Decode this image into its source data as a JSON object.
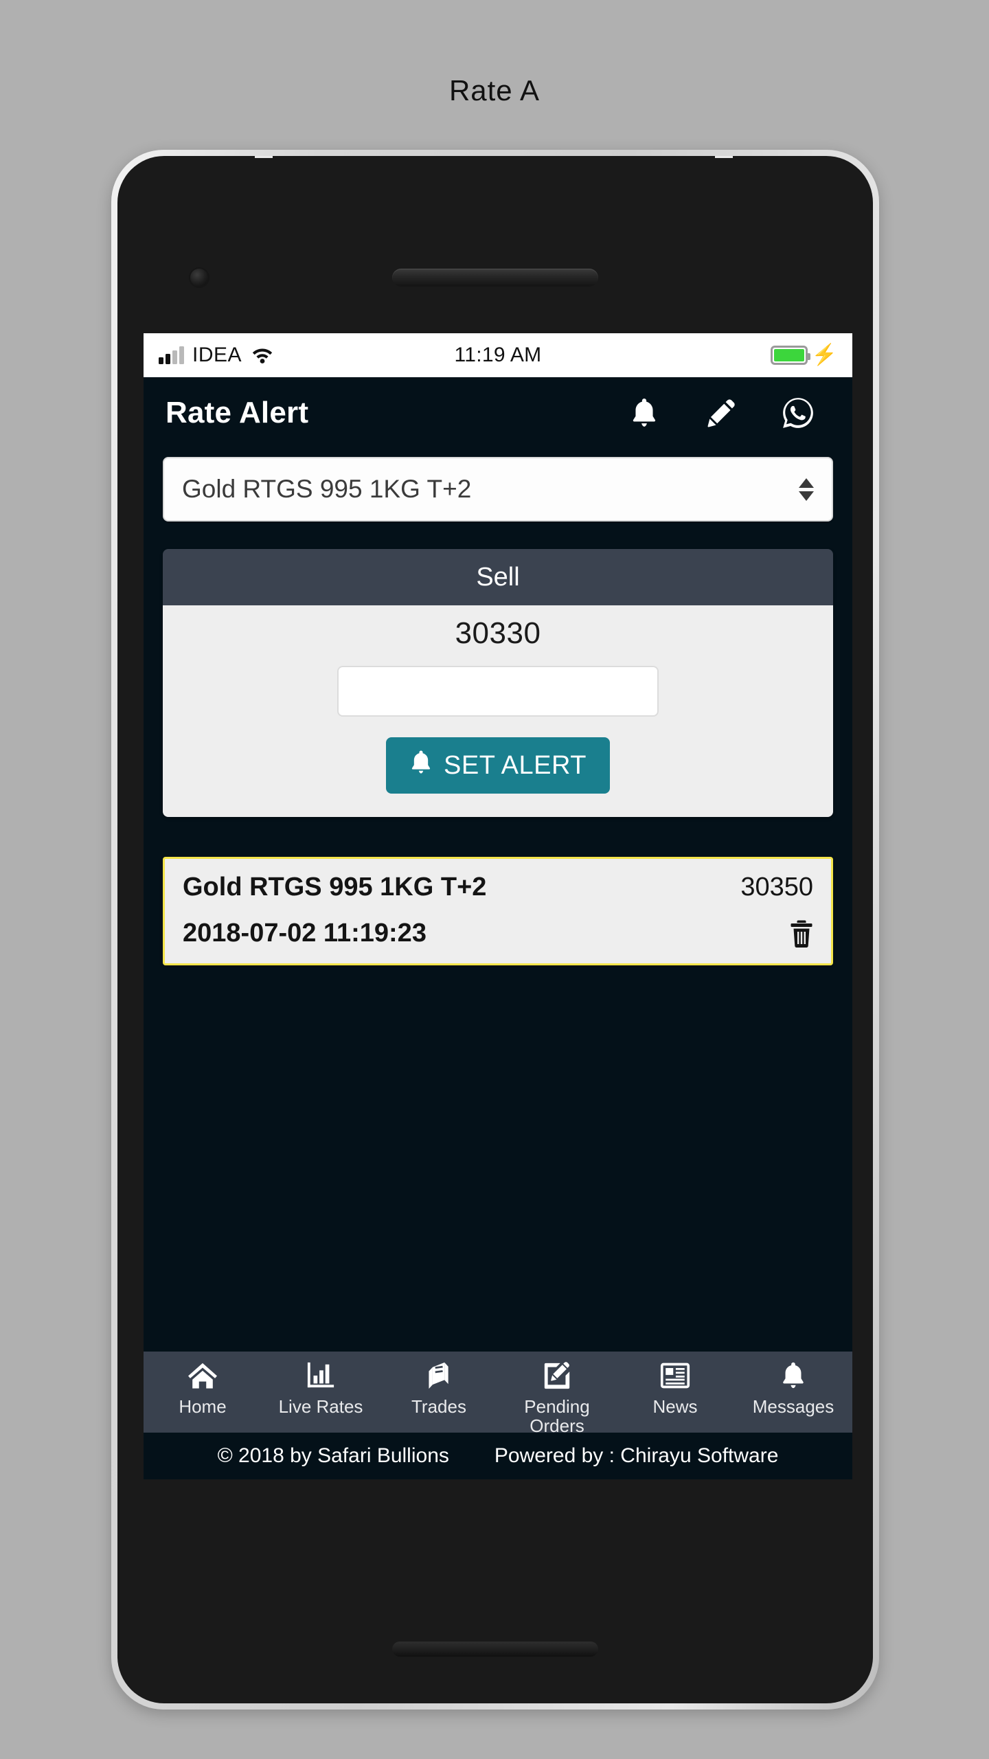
{
  "page": {
    "title": "Rate A"
  },
  "status_bar": {
    "carrier": "IDEA",
    "time": "11:19 AM",
    "signal_icon": "signal-bars-icon",
    "wifi_icon": "wifi-icon",
    "battery_icon": "battery-icon",
    "charging_icon": "lightning-bolt-icon",
    "battery_color": "#3cd63c"
  },
  "app_bar": {
    "title": "Rate Alert",
    "actions": [
      {
        "name": "bell-icon",
        "label": "Notifications"
      },
      {
        "name": "pencil-icon",
        "label": "Edit"
      },
      {
        "name": "whatsapp-icon",
        "label": "WhatsApp"
      }
    ]
  },
  "product_select": {
    "value": "Gold RTGS 995 1KG T+2",
    "stepper_icon": "updown-arrows-icon"
  },
  "sell_card": {
    "heading": "Sell",
    "price": "30330",
    "header_color": "#3b4350",
    "input": {
      "value": "",
      "placeholder": ""
    },
    "button": {
      "label": "SET ALERT",
      "icon": "bell-icon",
      "color": "#1a7f8e"
    }
  },
  "alerts": {
    "border_color": "#f5e54a",
    "items": [
      {
        "name": "Gold RTGS 995 1KG T+2",
        "price": "30350",
        "timestamp": "2018-07-02 11:19:23",
        "delete_icon": "trash-icon"
      }
    ]
  },
  "bottom_nav": {
    "background_color": "#39414e",
    "items": [
      {
        "label": "Home",
        "icon": "home-icon"
      },
      {
        "label": "Live Rates",
        "icon": "bar-chart-icon"
      },
      {
        "label": "Trades",
        "icon": "book-icon"
      },
      {
        "label": "Pending Orders",
        "icon": "edit-square-icon"
      },
      {
        "label": "News",
        "icon": "newspaper-icon"
      },
      {
        "label": "Messages",
        "icon": "bell-icon"
      }
    ]
  },
  "footer": {
    "copyright": "© 2018 by Safari Bullions",
    "powered_by": "Powered by : Chirayu Software"
  }
}
